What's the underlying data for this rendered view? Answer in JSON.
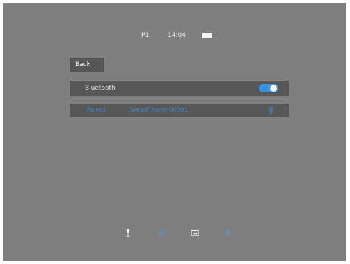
{
  "status_bar": {
    "preset": "P1",
    "time": "14:04",
    "battery_icon": "battery-icon"
  },
  "back_label": "Back",
  "bluetooth": {
    "label": "Bluetooth",
    "enabled": true,
    "accent_color": "#3d8fe0"
  },
  "device": {
    "status": "Paired",
    "name": "SmartTherm 00001",
    "icon": "bluetooth-icon",
    "text_color": "#3f86cf"
  },
  "bottom_bar": {
    "icons": [
      "microphone-icon",
      "settings-icon",
      "display-icon",
      "bluetooth-icon"
    ]
  },
  "colors": {
    "screen_bg": "#7f7f7f",
    "row_bg": "#575757"
  }
}
